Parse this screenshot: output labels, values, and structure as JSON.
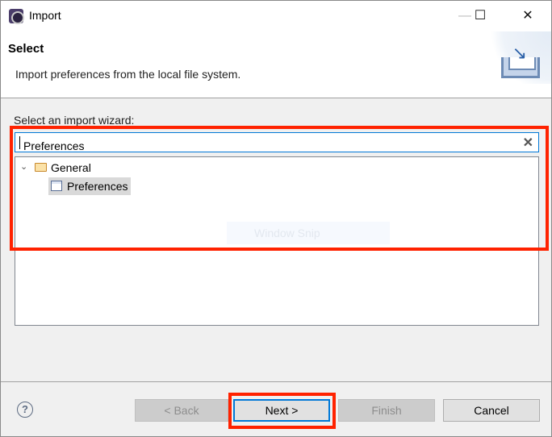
{
  "window": {
    "title": "Import",
    "minimize": "—",
    "maximize": "☐",
    "close": "✕"
  },
  "header": {
    "title": "Select",
    "description": "Import preferences from the local file system."
  },
  "main": {
    "label": "Select an import wizard:",
    "search": {
      "value": "Preferences",
      "clear": "✕"
    },
    "tree": [
      {
        "label": "General",
        "expanded": true,
        "children": [
          {
            "label": "Preferences",
            "selected": true
          }
        ]
      }
    ],
    "overlay": "Window Snip"
  },
  "buttons": {
    "help": "?",
    "back": "< Back",
    "next": "Next >",
    "finish": "Finish",
    "cancel": "Cancel"
  },
  "colors": {
    "highlight": "#ff2200",
    "focus": "#0078d7"
  }
}
